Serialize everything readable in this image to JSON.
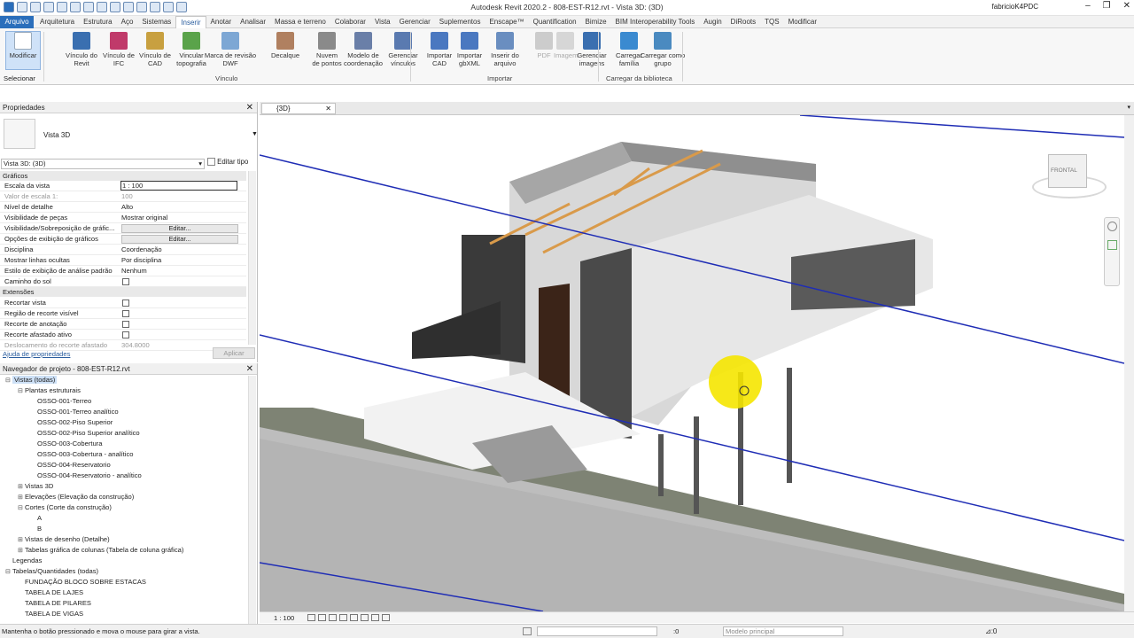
{
  "window": {
    "title": "Autodesk Revit 2020.2 - 808-EST-R12.rvt - Vista 3D: (3D)",
    "user": "fabricioK4PDC"
  },
  "tabs": [
    "Arquivo",
    "Arquitetura",
    "Estrutura",
    "Aço",
    "Sistemas",
    "Inserir",
    "Anotar",
    "Analisar",
    "Massa e terreno",
    "Colaborar",
    "Vista",
    "Gerenciar",
    "Suplementos",
    "Enscape™",
    "Quantification",
    "Bimize",
    "BIM Interoperability Tools",
    "Augin",
    "DiRoots",
    "TQS",
    "Modificar"
  ],
  "ribbon": {
    "select_label": "Selecionar",
    "buttons": [
      {
        "label1": "Modificar",
        "label2": ""
      },
      {
        "label1": "Vínculo do",
        "label2": "Revit"
      },
      {
        "label1": "Vínculo de",
        "label2": "IFC"
      },
      {
        "label1": "Vínculo de",
        "label2": "CAD"
      },
      {
        "label1": "Vincular",
        "label2": "topografia"
      },
      {
        "label1": "Marca de revisão",
        "label2": "DWF"
      },
      {
        "label1": "Decalque",
        "label2": ""
      },
      {
        "label1": "Nuvem",
        "label2": "de pontos"
      },
      {
        "label1": "Modelo de",
        "label2": "coordenação"
      },
      {
        "label1": "Gerenciar",
        "label2": "vínculos"
      },
      {
        "label1": "Importar",
        "label2": "CAD"
      },
      {
        "label1": "Importar",
        "label2": "gbXML"
      },
      {
        "label1": "Inserir do",
        "label2": "arquivo"
      },
      {
        "label1": "PDF",
        "label2": ""
      },
      {
        "label1": "Imagem",
        "label2": ""
      },
      {
        "label1": "Gerenciar",
        "label2": "imagens"
      },
      {
        "label1": "Carregar",
        "label2": "família"
      },
      {
        "label1": "Carregar como",
        "label2": "grupo"
      }
    ],
    "groups": [
      "Vínculo",
      "Importar",
      "Carregar da biblioteca"
    ]
  },
  "properties": {
    "title": "Propriedades",
    "type_name": "Vista 3D",
    "selector": "Vista 3D: (3D)",
    "edit_type": "Editar tipo",
    "sections": [
      "Gráficos",
      "Extensões"
    ],
    "rows": [
      {
        "k": "Escala da vista",
        "v": "1 : 100"
      },
      {
        "k": "Valor de escala    1:",
        "v": "100"
      },
      {
        "k": "Nível de detalhe",
        "v": "Alto"
      },
      {
        "k": "Visibilidade de peças",
        "v": "Mostrar original"
      },
      {
        "k": "Visibilidade/Sobreposição de gráfic...",
        "v": "Editar..."
      },
      {
        "k": "Opções de exibição de gráficos",
        "v": "Editar..."
      },
      {
        "k": "Disciplina",
        "v": "Coordenação"
      },
      {
        "k": "Mostrar linhas ocultas",
        "v": "Por disciplina"
      },
      {
        "k": "Estilo de exibição de análise padrão",
        "v": "Nenhum"
      },
      {
        "k": "Caminho do sol",
        "v": ""
      },
      {
        "k": "Recortar vista",
        "v": ""
      },
      {
        "k": "Região de recorte visível",
        "v": ""
      },
      {
        "k": "Recorte de anotação",
        "v": ""
      },
      {
        "k": "Recorte afastado ativo",
        "v": ""
      },
      {
        "k": "Deslocamento do recorte afastado",
        "v": "304.8000"
      }
    ],
    "help_link": "Ajuda de propriedades",
    "apply": "Aplicar"
  },
  "browser": {
    "title": "Navegador de projeto - 808-EST-R12.rvt",
    "nodes": [
      {
        "t": "Vistas (todas)",
        "lvl": 0,
        "exp": "-"
      },
      {
        "t": "Plantas estruturais",
        "lvl": 1,
        "exp": "-"
      },
      {
        "t": "OSSO-001-Terreo",
        "lvl": 2,
        "exp": ""
      },
      {
        "t": "OSSO-001-Terreo analítico",
        "lvl": 2,
        "exp": ""
      },
      {
        "t": "OSSO-002-Piso Superior",
        "lvl": 2,
        "exp": ""
      },
      {
        "t": "OSSO-002-Piso Superior analítico",
        "lvl": 2,
        "exp": ""
      },
      {
        "t": "OSSO-003-Cobertura",
        "lvl": 2,
        "exp": ""
      },
      {
        "t": "OSSO-003-Cobertura - analítico",
        "lvl": 2,
        "exp": ""
      },
      {
        "t": "OSSO-004-Reservatorio",
        "lvl": 2,
        "exp": ""
      },
      {
        "t": "OSSO-004-Reservatorio - analítico",
        "lvl": 2,
        "exp": ""
      },
      {
        "t": "Vistas 3D",
        "lvl": 1,
        "exp": "+"
      },
      {
        "t": "Elevações (Elevação da construção)",
        "lvl": 1,
        "exp": "+"
      },
      {
        "t": "Cortes (Corte da construção)",
        "lvl": 1,
        "exp": "-"
      },
      {
        "t": "A",
        "lvl": 2,
        "exp": ""
      },
      {
        "t": "B",
        "lvl": 2,
        "exp": ""
      },
      {
        "t": "Vistas de desenho (Detalhe)",
        "lvl": 1,
        "exp": "+"
      },
      {
        "t": "Tabelas gráfica de colunas (Tabela de coluna gráfica)",
        "lvl": 1,
        "exp": "+"
      },
      {
        "t": "Legendas",
        "lvl": 0,
        "exp": ""
      },
      {
        "t": "Tabelas/Quantidades (todas)",
        "lvl": 0,
        "exp": "-"
      },
      {
        "t": "FUNDAÇÃO BLOCO SOBRE ESTACAS",
        "lvl": 1,
        "exp": ""
      },
      {
        "t": "TABELA DE LAJES",
        "lvl": 1,
        "exp": ""
      },
      {
        "t": "TABELA DE PILARES",
        "lvl": 1,
        "exp": ""
      },
      {
        "t": "TABELA DE VIGAS",
        "lvl": 1,
        "exp": ""
      }
    ]
  },
  "view": {
    "tab": "{3D}",
    "scale": "1 : 100",
    "viewcube_label": "FRONTAL"
  },
  "status": {
    "message": "Mantenha o botão pressionado e mova o mouse para girar a vista.",
    "count": ":0",
    "model": "Modelo principal"
  },
  "colors": {
    "accent": "#2a6ebb",
    "cursor": "#f5e600",
    "gridline": "#1f2db5"
  }
}
